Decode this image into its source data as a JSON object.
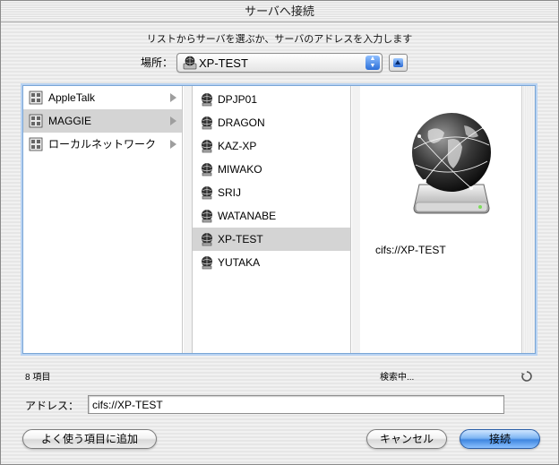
{
  "window": {
    "title": "サーバへ接続"
  },
  "instruction": "リストからサーバを選ぶか、サーバのアドレスを入力します",
  "location": {
    "label": "場所：",
    "selected": "XP-TEST",
    "icon": "network-volume-icon"
  },
  "browser": {
    "column1": [
      {
        "label": "AppleTalk",
        "icon": "network-icon",
        "selected": false
      },
      {
        "label": "MAGGIE",
        "icon": "network-icon",
        "selected": true
      },
      {
        "label": "ローカルネットワーク",
        "icon": "network-icon",
        "selected": false
      }
    ],
    "column2": [
      {
        "label": "DPJP01",
        "icon": "server-icon",
        "selected": false
      },
      {
        "label": "DRAGON",
        "icon": "server-icon",
        "selected": false
      },
      {
        "label": "KAZ-XP",
        "icon": "server-icon",
        "selected": false
      },
      {
        "label": "MIWAKO",
        "icon": "server-icon",
        "selected": false
      },
      {
        "label": "SRIJ",
        "icon": "server-icon",
        "selected": false
      },
      {
        "label": "WATANABE",
        "icon": "server-icon",
        "selected": false
      },
      {
        "label": "XP-TEST",
        "icon": "server-icon",
        "selected": true
      },
      {
        "label": "YUTAKA",
        "icon": "server-icon",
        "selected": false
      }
    ],
    "preview": {
      "caption": "cifs://XP-TEST",
      "icon": "network-server-globe-icon"
    }
  },
  "status": {
    "item_count": "8 項目",
    "searching": "検索中..."
  },
  "address": {
    "label": "アドレス：",
    "value": "cifs://XP-TEST"
  },
  "buttons": {
    "add_favorite": "よく使う項目に追加",
    "cancel": "キャンセル",
    "connect": "接続"
  },
  "colors": {
    "selection": "#d4d4d4",
    "accent": "#3f86e0",
    "focus_ring": "#7aa6d6"
  }
}
